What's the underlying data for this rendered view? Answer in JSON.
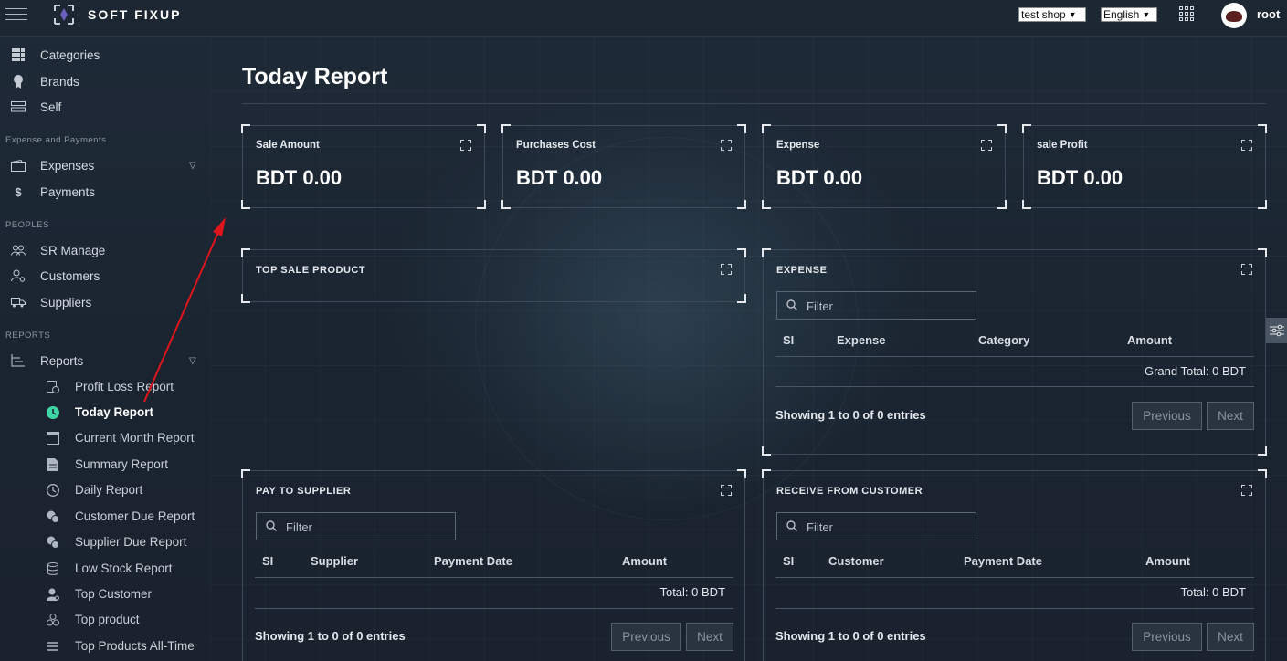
{
  "header": {
    "brand": "SOFT FIXUP",
    "shop_select": "test shop",
    "language_select": "English",
    "username": "root"
  },
  "sidebar": {
    "top_items": [
      {
        "label": "Categories",
        "icon": "grid-icon"
      },
      {
        "label": "Brands",
        "icon": "badge-icon"
      },
      {
        "label": "Self",
        "icon": "shelf-icon"
      }
    ],
    "section_expense": "Expense and Payments",
    "expense_items": [
      {
        "label": "Expenses",
        "icon": "wallet-icon"
      },
      {
        "label": "Payments",
        "icon": "dollar-icon"
      }
    ],
    "section_peoples": "PEOPLES",
    "people_items": [
      {
        "label": "SR Manage",
        "icon": "group-icon"
      },
      {
        "label": "Customers",
        "icon": "user-cog-icon"
      },
      {
        "label": "Suppliers",
        "icon": "truck-icon"
      }
    ],
    "section_reports": "REPORTS",
    "reports_label": "Reports",
    "report_items": [
      {
        "label": "Profit Loss Report",
        "icon": "profit-loss-icon"
      },
      {
        "label": "Today Report",
        "icon": "clock-icon"
      },
      {
        "label": "Current Month Report",
        "icon": "calendar-icon"
      },
      {
        "label": "Summary Report",
        "icon": "document-icon"
      },
      {
        "label": "Daily Report",
        "icon": "clock-outline-icon"
      },
      {
        "label": "Customer Due Report",
        "icon": "coins-icon"
      },
      {
        "label": "Supplier Due Report",
        "icon": "coins-icon"
      },
      {
        "label": "Low Stock Report",
        "icon": "database-icon"
      },
      {
        "label": "Top Customer",
        "icon": "user-icon"
      },
      {
        "label": "Top product",
        "icon": "boxes-icon"
      },
      {
        "label": "Top Products All-Time",
        "icon": "list-icon"
      }
    ]
  },
  "main": {
    "title": "Today Report",
    "stats": [
      {
        "label": "Sale Amount",
        "value": "BDT 0.00"
      },
      {
        "label": "Purchases Cost",
        "value": "BDT 0.00"
      },
      {
        "label": "Expense",
        "value": "BDT 0.00"
      },
      {
        "label": "sale Profit",
        "value": "BDT 0.00"
      }
    ],
    "top_sale": {
      "title": "TOP SALE PRODUCT"
    },
    "expense": {
      "title": "EXPENSE",
      "filter_placeholder": "Filter",
      "columns": [
        "SI",
        "Expense",
        "Category",
        "Amount"
      ],
      "total": "Grand Total: 0 BDT",
      "showing": "Showing 1 to 0 of 0 entries",
      "prev": "Previous",
      "next": "Next"
    },
    "pay_supplier": {
      "title": "PAY TO SUPPLIER",
      "filter_placeholder": "Filter",
      "columns": [
        "SI",
        "Supplier",
        "Payment Date",
        "Amount"
      ],
      "total": "Total: 0 BDT",
      "showing": "Showing 1 to 0 of 0 entries",
      "prev": "Previous",
      "next": "Next"
    },
    "receive_customer": {
      "title": "RECEIVE FROM CUSTOMER",
      "filter_placeholder": "Filter",
      "columns": [
        "SI",
        "Customer",
        "Payment Date",
        "Amount"
      ],
      "total": "Total: 0 BDT",
      "showing": "Showing 1 to 0 of 0 entries",
      "prev": "Previous",
      "next": "Next"
    }
  },
  "colors": {
    "active_icon": "#3dd6a4",
    "annotation_arrow": "#e0141b"
  }
}
